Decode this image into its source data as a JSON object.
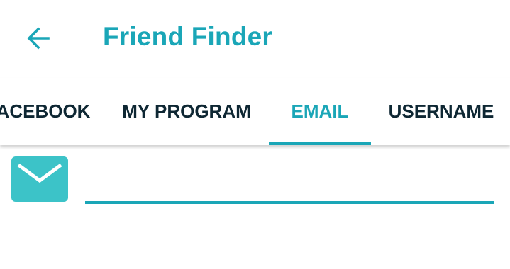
{
  "header": {
    "title": "Friend Finder",
    "back_icon": "arrow-left-icon"
  },
  "tabs": [
    {
      "label": "ACEBOOK",
      "active": false
    },
    {
      "label": "MY PROGRAM",
      "active": false
    },
    {
      "label": "EMAIL",
      "active": true
    },
    {
      "label": "USERNAME",
      "active": false
    }
  ],
  "email": {
    "icon": "envelope-icon",
    "value": "",
    "placeholder": ""
  },
  "colors": {
    "accent": "#1aa6b7",
    "icon_bg": "#3cc3c8",
    "text_dark": "#0e2733",
    "background": "#ffffff"
  }
}
